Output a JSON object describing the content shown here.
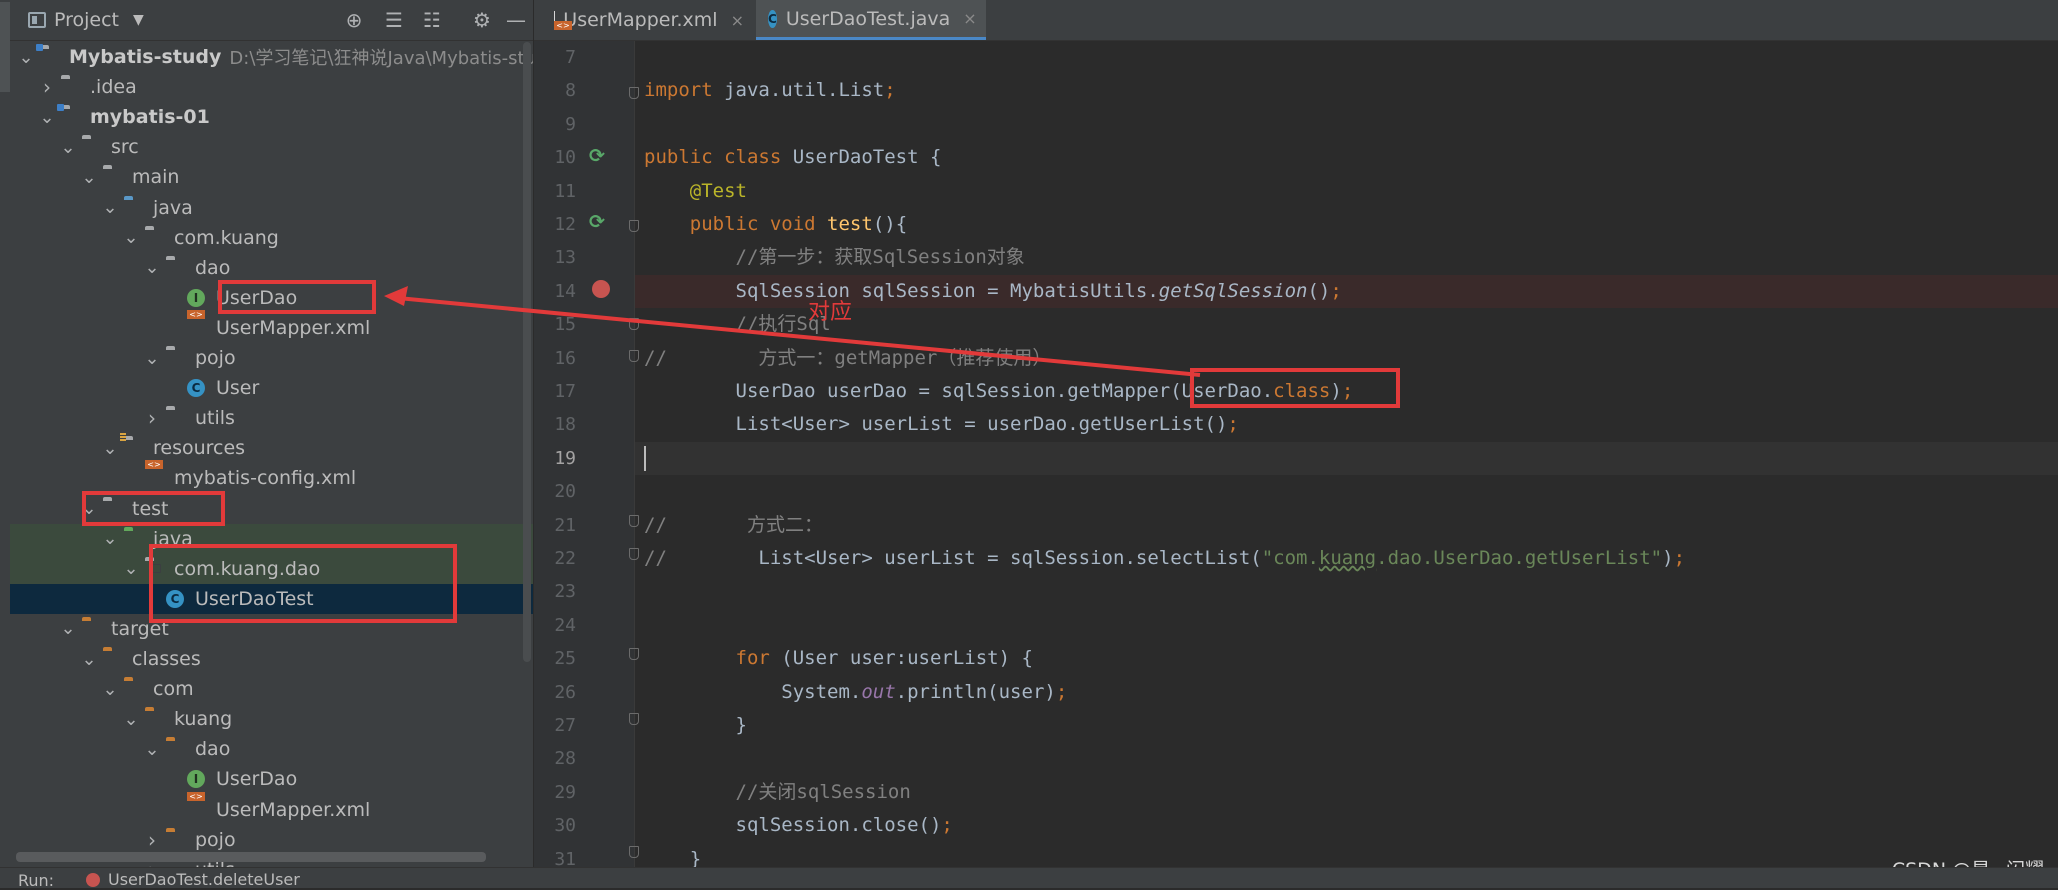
{
  "project_panel": {
    "title": "Project",
    "tools": [
      "locate-icon",
      "expand-all-icon",
      "collapse-all-icon",
      "gear-icon",
      "hide-icon"
    ],
    "project_path": "D:\\学习笔记\\狂神说Java\\Mybatis-stud",
    "tree": [
      {
        "label": "Mybatis-study",
        "icon": "module-folder",
        "level": 0,
        "expanded": true
      },
      {
        "label": ".idea",
        "icon": "folder",
        "level": 1,
        "expanded": false
      },
      {
        "label": "mybatis-01",
        "icon": "module-folder",
        "level": 1,
        "expanded": true
      },
      {
        "label": "src",
        "icon": "folder",
        "level": 2,
        "expanded": true
      },
      {
        "label": "main",
        "icon": "folder",
        "level": 3,
        "expanded": true
      },
      {
        "label": "java",
        "icon": "source-folder",
        "level": 4,
        "expanded": true
      },
      {
        "label": "com.kuang",
        "icon": "package",
        "level": 5,
        "expanded": true
      },
      {
        "label": "dao",
        "icon": "package",
        "level": 6,
        "expanded": true
      },
      {
        "label": "UserDao",
        "icon": "interface",
        "level": 7
      },
      {
        "label": "UserMapper.xml",
        "icon": "xml-file",
        "level": 7
      },
      {
        "label": "pojo",
        "icon": "package",
        "level": 6,
        "expanded": true
      },
      {
        "label": "User",
        "icon": "class",
        "level": 7
      },
      {
        "label": "utils",
        "icon": "package",
        "level": 6,
        "expanded": false
      },
      {
        "label": "resources",
        "icon": "resources-folder",
        "level": 4,
        "expanded": true
      },
      {
        "label": "mybatis-config.xml",
        "icon": "xml-file",
        "level": 5
      },
      {
        "label": "test",
        "icon": "folder",
        "level": 3,
        "expanded": true
      },
      {
        "label": "java",
        "icon": "test-folder",
        "level": 4,
        "expanded": true
      },
      {
        "label": "com.kuang.dao",
        "icon": "package",
        "level": 5,
        "expanded": true
      },
      {
        "label": "UserDaoTest",
        "icon": "test-class",
        "level": 6
      },
      {
        "label": "target",
        "icon": "excluded-folder",
        "level": 2,
        "expanded": true
      },
      {
        "label": "classes",
        "icon": "excluded-folder",
        "level": 3,
        "expanded": true
      },
      {
        "label": "com",
        "icon": "excluded-folder",
        "level": 4,
        "expanded": true
      },
      {
        "label": "kuang",
        "icon": "excluded-folder",
        "level": 5,
        "expanded": true
      },
      {
        "label": "dao",
        "icon": "excluded-folder",
        "level": 6,
        "expanded": true
      },
      {
        "label": "UserDao",
        "icon": "interface",
        "level": 7
      },
      {
        "label": "UserMapper.xml",
        "icon": "xml-file",
        "level": 7
      },
      {
        "label": "pojo",
        "icon": "excluded-folder",
        "level": 6,
        "expanded": false
      },
      {
        "label": "utils",
        "icon": "excluded-folder",
        "level": 6,
        "expanded": false
      }
    ]
  },
  "tabs": [
    {
      "label": "UserMapper.xml",
      "icon": "xml-file",
      "active": false
    },
    {
      "label": "UserDaoTest.java",
      "icon": "test-class",
      "active": true
    }
  ],
  "line_numbers": [
    "7",
    "8",
    "9",
    "10",
    "11",
    "12",
    "13",
    "14",
    "15",
    "16",
    "17",
    "18",
    "19",
    "20",
    "21",
    "22",
    "23",
    "24",
    "25",
    "26",
    "27",
    "28",
    "29",
    "30",
    "31"
  ],
  "code_lines": [
    [],
    [
      [
        "kw",
        "import "
      ],
      [
        "",
        "java.util.List"
      ],
      [
        "kw",
        ";"
      ]
    ],
    [],
    [
      [
        "kw",
        "public class "
      ],
      [
        "",
        "UserDaoTest {"
      ]
    ],
    [
      [
        "",
        "    "
      ],
      [
        "ann",
        "@Test"
      ]
    ],
    [
      [
        "",
        "    "
      ],
      [
        "kw",
        "public void "
      ],
      [
        "fn",
        "test"
      ],
      [
        "",
        "(){"
      ]
    ],
    [
      [
        "",
        "        "
      ],
      [
        "cm",
        "//第一步：获取SqlSession对象"
      ]
    ],
    [
      [
        "",
        "        SqlSession sqlSession = MybatisUtils."
      ],
      [
        "it",
        "getSqlSession"
      ],
      [
        "",
        "()"
      ],
      [
        "kw",
        ";"
      ]
    ],
    [
      [
        "",
        "        "
      ],
      [
        "cm",
        "//执行Sql"
      ]
    ],
    [
      [
        "cm",
        "//        方式一：getMapper（推荐使用）"
      ]
    ],
    [
      [
        "",
        "        UserDao userDao = sqlSession.getMapper(UserDao."
      ],
      [
        "kw",
        "class"
      ],
      [
        "",
        ")"
      ],
      [
        "kw",
        ";"
      ]
    ],
    [
      [
        "",
        "        List<User> userList = userDao.getUserList()"
      ],
      [
        "kw",
        ";"
      ]
    ],
    [],
    [],
    [
      [
        "cm",
        "//       方式二："
      ]
    ],
    [
      [
        "cm",
        "//        "
      ],
      [
        "",
        "List<User> userList = sqlSession.selectList("
      ],
      [
        "st",
        "\"com."
      ],
      [
        "sq",
        "kuang"
      ],
      [
        "st",
        ".dao.UserDao.getUserList\""
      ],
      [
        "",
        ")"
      ],
      [
        "kw",
        ";"
      ]
    ],
    [],
    [],
    [
      [
        "",
        "        "
      ],
      [
        "kw",
        "for "
      ],
      [
        "",
        "(User user:userList) {"
      ]
    ],
    [
      [
        "",
        "            System."
      ],
      [
        "fld",
        "out"
      ],
      [
        "",
        ".println(user)"
      ],
      [
        "kw",
        ";"
      ]
    ],
    [
      [
        "",
        "        }"
      ]
    ],
    [],
    [
      [
        "",
        "        "
      ],
      [
        "cm",
        "//关闭sqlSession"
      ]
    ],
    [
      [
        "",
        "        sqlSession.close()"
      ],
      [
        "kw",
        ";"
      ]
    ],
    [
      [
        "",
        "    }"
      ]
    ]
  ],
  "annotation": {
    "note": "对应"
  },
  "run_bar": {
    "label": "Run:",
    "config": "UserDaoTest.deleteUser"
  },
  "watermark": "CSDN @星~闪耀"
}
